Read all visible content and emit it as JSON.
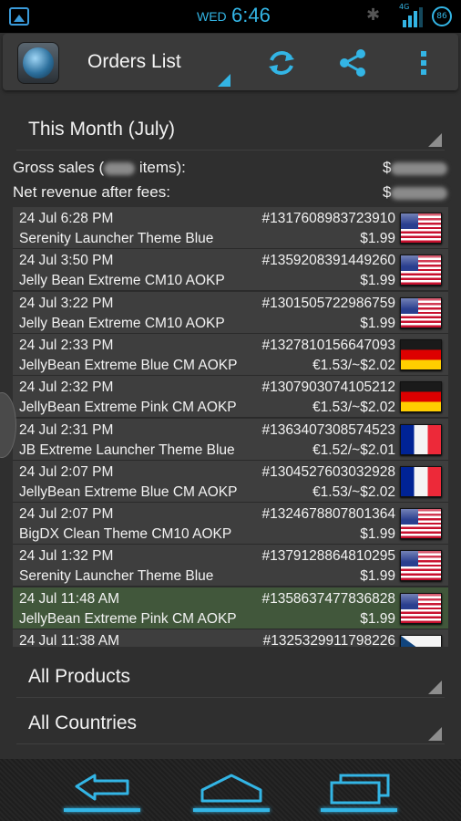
{
  "status_bar": {
    "day": "WED",
    "time": "6:46",
    "network_label": "4G",
    "battery_level": "86"
  },
  "action_bar": {
    "title": "Orders List"
  },
  "period": {
    "label": "This Month (July)"
  },
  "summary": {
    "gross_label_start": "Gross sales (",
    "gross_label_end": " items):",
    "gross_value_prefix": "$",
    "net_label": "Net revenue after fees:",
    "net_value_prefix": "$"
  },
  "orders": [
    {
      "date": "24 Jul 6:28 PM",
      "id": "#1317608983723910",
      "name": "Serenity Launcher Theme Blue",
      "price": "$1.99",
      "flag": "us",
      "highlighted": false
    },
    {
      "date": "24 Jul 3:50 PM",
      "id": "#1359208391449260",
      "name": "Jelly Bean Extreme CM10 AOKP",
      "price": "$1.99",
      "flag": "us",
      "highlighted": false
    },
    {
      "date": "24 Jul 3:22 PM",
      "id": "#1301505722986759",
      "name": "Jelly Bean Extreme CM10 AOKP",
      "price": "$1.99",
      "flag": "us",
      "highlighted": false
    },
    {
      "date": "24 Jul 2:33 PM",
      "id": "#1327810156647093",
      "name": "JellyBean Extreme Blue CM AOKP",
      "price": "€1.53/~$2.02",
      "flag": "de",
      "highlighted": false
    },
    {
      "date": "24 Jul 2:32 PM",
      "id": "#1307903074105212",
      "name": "JellyBean Extreme Pink CM AOKP",
      "price": "€1.53/~$2.02",
      "flag": "de",
      "highlighted": false
    },
    {
      "date": "24 Jul 2:31 PM",
      "id": "#1363407308574523",
      "name": "JB Extreme Launcher Theme Blue",
      "price": "€1.52/~$2.01",
      "flag": "fr",
      "highlighted": false
    },
    {
      "date": "24 Jul 2:07 PM",
      "id": "#1304527603032928",
      "name": "JellyBean Extreme Blue CM AOKP",
      "price": "€1.53/~$2.02",
      "flag": "fr",
      "highlighted": false
    },
    {
      "date": "24 Jul 2:07 PM",
      "id": "#1324678807801364",
      "name": "BigDX Clean Theme CM10 AOKP",
      "price": "$1.99",
      "flag": "us",
      "highlighted": false
    },
    {
      "date": "24 Jul 1:32 PM",
      "id": "#1379128864810295",
      "name": "Serenity Launcher Theme Blue",
      "price": "$1.99",
      "flag": "us",
      "highlighted": false
    },
    {
      "date": "24 Jul 11:48 AM",
      "id": "#1358637477836828",
      "name": "JellyBean Extreme Pink CM AOKP",
      "price": "$1.99",
      "flag": "us",
      "highlighted": true
    },
    {
      "date": "24 Jul 11:38 AM",
      "id": "#1325329911798226",
      "name": "",
      "price": "",
      "flag": "cz",
      "highlighted": false
    }
  ],
  "filters": {
    "products_label": "All Products",
    "countries_label": "All Countries"
  },
  "colors": {
    "accent": "#33b5e5",
    "highlight_row": "#41573b",
    "row": "#3e3e3e"
  },
  "icons": {
    "refresh": "refresh-icon",
    "share": "share-icon",
    "overflow": "overflow-menu-icon",
    "back": "back-icon",
    "home": "home-icon",
    "recent": "recent-apps-icon"
  }
}
